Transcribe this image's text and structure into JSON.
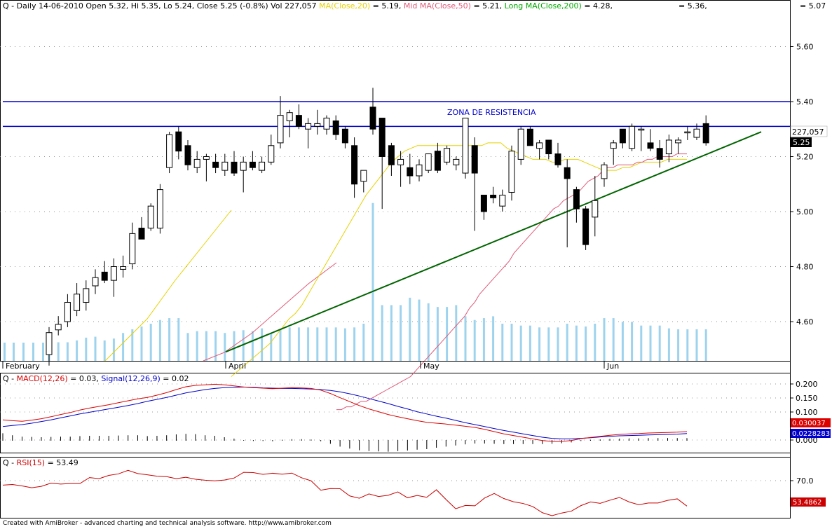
{
  "header": {
    "symbol": "Q",
    "title_main": "Q - Daily 14-06-2010 Open 5.32, Hi 5.35, Lo 5.24, Close 5.25 (-0.8%) Vol 227,057",
    "ma20_label": "MA(Close,20)",
    "ma20_value": "= 5.19,",
    "ma50_label": "Mid MA(Close,50)",
    "ma50_value": "= 5.21,",
    "ma200_label": "Long MA(Close,200)",
    "ma200_value": "= 4.28,",
    "extra_value_1": "= 5.36,",
    "extra_value_2": "= 5.07"
  },
  "price_panel": {
    "annotation": "ZONA DE RESISTENCIA",
    "volume_badge": "227,057",
    "close_badge": "5.25",
    "resistance_levels": [
      5.4,
      5.31
    ],
    "y_ticks": [
      "5.60",
      "5.40",
      "5.20",
      "5.00",
      "4.80",
      "4.60"
    ],
    "x_month_labels": [
      "February",
      "April",
      "May",
      "Jun"
    ]
  },
  "macd_panel": {
    "label_prefix": "Q - ",
    "macd_label": "MACD(12,26)",
    "macd_value": "= 0.03,",
    "signal_label": "Signal(12,26,9)",
    "signal_value": "= 0.02",
    "y_ticks": [
      "0.200",
      "0.150",
      "0.100",
      "0.000"
    ],
    "badge_macd": "0.030037",
    "badge_signal": "0.0228283"
  },
  "rsi_panel": {
    "label_prefix": "Q - ",
    "rsi_label": "RSI(15)",
    "rsi_value": "= 53.49",
    "y_ticks": [
      "70.0"
    ],
    "badge_rsi": "53.4862"
  },
  "footer": {
    "text": "Created with AmiBroker - advanced charting and technical analysis software. http://www.amibroker.com"
  },
  "colors": {
    "up_candle": "#ffffff",
    "down_candle": "#000000",
    "ma20": "#e6d200",
    "ma50": "#e05a78",
    "ma200": "#00aa00",
    "resistance": "#0000cc",
    "trendline": "#006400",
    "volume": "#9ed3ee",
    "macd": "#dd0000",
    "signal": "#0000cc",
    "rsi": "#cc0000"
  },
  "chart_data": {
    "type": "candlestick",
    "period": "Daily",
    "last_date": "14-06-2010",
    "candles": [
      {
        "o": 4.48,
        "h": 4.58,
        "l": 4.44,
        "c": 4.56
      },
      {
        "o": 4.57,
        "h": 4.62,
        "l": 4.55,
        "c": 4.59
      },
      {
        "o": 4.6,
        "h": 4.7,
        "l": 4.58,
        "c": 4.67
      },
      {
        "o": 4.64,
        "h": 4.74,
        "l": 4.62,
        "c": 4.7
      },
      {
        "o": 4.67,
        "h": 4.75,
        "l": 4.64,
        "c": 4.72
      },
      {
        "o": 4.73,
        "h": 4.79,
        "l": 4.7,
        "c": 4.76
      },
      {
        "o": 4.78,
        "h": 4.82,
        "l": 4.74,
        "c": 4.75
      },
      {
        "o": 4.75,
        "h": 4.83,
        "l": 4.69,
        "c": 4.8
      },
      {
        "o": 4.79,
        "h": 4.84,
        "l": 4.76,
        "c": 4.8
      },
      {
        "o": 4.81,
        "h": 4.96,
        "l": 4.79,
        "c": 4.92
      },
      {
        "o": 4.94,
        "h": 4.98,
        "l": 4.91,
        "c": 4.9
      },
      {
        "o": 4.94,
        "h": 5.03,
        "l": 4.93,
        "c": 5.02
      },
      {
        "o": 4.94,
        "h": 5.1,
        "l": 4.92,
        "c": 5.08
      },
      {
        "o": 5.16,
        "h": 5.29,
        "l": 5.14,
        "c": 5.28
      },
      {
        "o": 5.29,
        "h": 5.31,
        "l": 5.19,
        "c": 5.22
      },
      {
        "o": 5.24,
        "h": 5.26,
        "l": 5.15,
        "c": 5.17
      },
      {
        "o": 5.16,
        "h": 5.22,
        "l": 5.14,
        "c": 5.19
      },
      {
        "o": 5.19,
        "h": 5.21,
        "l": 5.11,
        "c": 5.2
      },
      {
        "o": 5.18,
        "h": 5.21,
        "l": 5.14,
        "c": 5.16
      },
      {
        "o": 5.15,
        "h": 5.21,
        "l": 5.13,
        "c": 5.18
      },
      {
        "o": 5.18,
        "h": 5.22,
        "l": 5.13,
        "c": 5.14
      },
      {
        "o": 5.15,
        "h": 5.2,
        "l": 5.07,
        "c": 5.18
      },
      {
        "o": 5.18,
        "h": 5.22,
        "l": 5.15,
        "c": 5.16
      },
      {
        "o": 5.15,
        "h": 5.2,
        "l": 5.14,
        "c": 5.18
      },
      {
        "o": 5.18,
        "h": 5.28,
        "l": 5.17,
        "c": 5.24
      },
      {
        "o": 5.25,
        "h": 5.42,
        "l": 5.23,
        "c": 5.35
      },
      {
        "o": 5.33,
        "h": 5.37,
        "l": 5.27,
        "c": 5.36
      },
      {
        "o": 5.35,
        "h": 5.39,
        "l": 5.3,
        "c": 5.31
      },
      {
        "o": 5.3,
        "h": 5.34,
        "l": 5.23,
        "c": 5.32
      },
      {
        "o": 5.31,
        "h": 5.37,
        "l": 5.28,
        "c": 5.32
      },
      {
        "o": 5.3,
        "h": 5.35,
        "l": 5.28,
        "c": 5.34
      },
      {
        "o": 5.33,
        "h": 5.35,
        "l": 5.26,
        "c": 5.28
      },
      {
        "o": 5.3,
        "h": 5.31,
        "l": 5.23,
        "c": 5.25
      },
      {
        "o": 5.24,
        "h": 5.27,
        "l": 5.05,
        "c": 5.1
      },
      {
        "o": 5.11,
        "h": 5.15,
        "l": 5.07,
        "c": 5.15
      },
      {
        "o": 5.38,
        "h": 5.45,
        "l": 5.28,
        "c": 5.3
      },
      {
        "o": 5.34,
        "h": 5.34,
        "l": 5.01,
        "c": 5.2
      },
      {
        "o": 5.24,
        "h": 5.25,
        "l": 5.13,
        "c": 5.17
      },
      {
        "o": 5.17,
        "h": 5.22,
        "l": 5.09,
        "c": 5.19
      },
      {
        "o": 5.16,
        "h": 5.21,
        "l": 5.1,
        "c": 5.13
      },
      {
        "o": 5.13,
        "h": 5.19,
        "l": 5.11,
        "c": 5.17
      },
      {
        "o": 5.15,
        "h": 5.21,
        "l": 5.14,
        "c": 5.21
      },
      {
        "o": 5.22,
        "h": 5.25,
        "l": 5.14,
        "c": 5.15
      },
      {
        "o": 5.18,
        "h": 5.24,
        "l": 5.17,
        "c": 5.23
      },
      {
        "o": 5.17,
        "h": 5.2,
        "l": 5.15,
        "c": 5.19
      },
      {
        "o": 5.14,
        "h": 5.34,
        "l": 5.12,
        "c": 5.34
      },
      {
        "o": 5.24,
        "h": 5.27,
        "l": 4.93,
        "c": 5.14
      },
      {
        "o": 5.06,
        "h": 5.06,
        "l": 4.97,
        "c": 5.0
      },
      {
        "o": 5.06,
        "h": 5.09,
        "l": 5.03,
        "c": 5.05
      },
      {
        "o": 5.02,
        "h": 5.08,
        "l": 5.0,
        "c": 5.06
      },
      {
        "o": 5.07,
        "h": 5.24,
        "l": 5.04,
        "c": 5.22
      },
      {
        "o": 5.19,
        "h": 5.31,
        "l": 5.17,
        "c": 5.3
      },
      {
        "o": 5.3,
        "h": 5.31,
        "l": 5.24,
        "c": 5.24
      },
      {
        "o": 5.23,
        "h": 5.26,
        "l": 5.19,
        "c": 5.25
      },
      {
        "o": 5.26,
        "h": 5.26,
        "l": 5.19,
        "c": 5.21
      },
      {
        "o": 5.21,
        "h": 5.25,
        "l": 5.16,
        "c": 5.17
      },
      {
        "o": 5.16,
        "h": 5.19,
        "l": 4.87,
        "c": 5.12
      },
      {
        "o": 5.08,
        "h": 5.09,
        "l": 4.96,
        "c": 5.01
      },
      {
        "o": 5.01,
        "h": 5.02,
        "l": 4.86,
        "c": 4.88
      },
      {
        "o": 4.98,
        "h": 5.13,
        "l": 4.91,
        "c": 5.04
      },
      {
        "o": 5.12,
        "h": 5.18,
        "l": 5.09,
        "c": 5.17
      },
      {
        "o": 5.23,
        "h": 5.26,
        "l": 5.17,
        "c": 5.25
      },
      {
        "o": 5.3,
        "h": 5.3,
        "l": 5.23,
        "c": 5.25
      },
      {
        "o": 5.23,
        "h": 5.32,
        "l": 5.22,
        "c": 5.31
      },
      {
        "o": 5.3,
        "h": 5.31,
        "l": 5.22,
        "c": 5.3
      },
      {
        "o": 5.25,
        "h": 5.3,
        "l": 5.22,
        "c": 5.23
      },
      {
        "o": 5.23,
        "h": 5.26,
        "l": 5.16,
        "c": 5.19
      },
      {
        "o": 5.21,
        "h": 5.28,
        "l": 5.18,
        "c": 5.26
      },
      {
        "o": 5.25,
        "h": 5.27,
        "l": 5.21,
        "c": 5.26
      },
      {
        "o": 5.29,
        "h": 5.31,
        "l": 5.26,
        "c": 5.29
      },
      {
        "o": 5.27,
        "h": 5.32,
        "l": 5.26,
        "c": 5.3
      },
      {
        "o": 5.32,
        "h": 5.35,
        "l": 5.24,
        "c": 5.25
      }
    ],
    "ma20": [
      4.4,
      4.42,
      4.44,
      4.46,
      4.48,
      4.5,
      4.52,
      4.55,
      4.58,
      4.61,
      4.63,
      4.66,
      4.7,
      4.74,
      4.78,
      4.82,
      4.86,
      4.9,
      4.94,
      4.98,
      5.02,
      5.06,
      5.09,
      5.12,
      5.15,
      5.18,
      5.2,
      5.22,
      5.23,
      5.24,
      5.24,
      5.24,
      5.24,
      5.24,
      5.24,
      5.24,
      5.24,
      5.24,
      5.24,
      5.24,
      5.25,
      5.25,
      5.25,
      5.23,
      5.22,
      5.21,
      5.2,
      5.19,
      5.19,
      5.19,
      5.18,
      5.18,
      5.19,
      5.19,
      5.19,
      5.18,
      5.17,
      5.16,
      5.15,
      5.15,
      5.15,
      5.16,
      5.16,
      5.17,
      5.18,
      5.18,
      5.18,
      5.18,
      5.19,
      5.19,
      5.19,
      5.19
    ],
    "ma50": [
      4.28,
      4.28,
      4.29,
      4.29,
      4.3,
      4.31,
      4.31,
      4.32,
      4.33,
      4.34,
      4.35,
      4.36,
      4.37,
      4.38,
      4.39,
      4.4,
      4.42,
      4.44,
      4.46,
      4.48,
      4.5,
      4.52,
      4.54,
      4.56,
      4.58,
      4.6,
      4.62,
      4.65,
      4.67,
      4.7,
      4.72,
      4.74,
      4.76,
      4.78,
      4.8,
      4.82,
      4.85,
      4.87,
      4.89,
      4.91,
      4.93,
      4.95,
      4.97,
      4.99,
      5.01,
      5.02,
      5.04,
      5.05,
      5.06,
      5.07,
      5.09,
      5.11,
      5.12,
      5.13,
      5.15,
      5.16,
      5.16,
      5.17,
      5.17,
      5.17,
      5.17,
      5.18,
      5.18,
      5.19,
      5.19,
      5.2,
      5.2,
      5.2,
      5.2,
      5.21,
      5.21,
      5.21
    ],
    "volume": [
      100,
      100,
      100,
      110,
      125,
      130,
      110,
      120,
      150,
      170,
      185,
      200,
      220,
      230,
      230,
      150,
      160,
      160,
      160,
      150,
      160,
      165,
      160,
      175,
      150,
      170,
      180,
      180,
      180,
      180,
      180,
      180,
      175,
      180,
      200,
      850,
      300,
      300,
      300,
      340,
      330,
      310,
      290,
      290,
      300,
      240,
      220,
      230,
      240,
      200,
      200,
      190,
      190,
      180,
      180,
      180,
      200,
      190,
      185,
      200,
      230,
      230,
      210,
      210,
      190,
      190,
      190,
      175,
      170,
      170,
      170,
      170
    ],
    "resistance_lines": [
      5.4,
      5.31
    ],
    "trendline": {
      "from_index": 26,
      "from_price": 4.49,
      "to_index": 87,
      "to_price": 5.29
    },
    "macd": [
      0.072,
      0.069,
      0.067,
      0.071,
      0.076,
      0.083,
      0.091,
      0.098,
      0.107,
      0.114,
      0.12,
      0.126,
      0.133,
      0.14,
      0.147,
      0.152,
      0.16,
      0.169,
      0.18,
      0.19,
      0.195,
      0.197,
      0.199,
      0.197,
      0.193,
      0.189,
      0.187,
      0.185,
      0.183,
      0.185,
      0.187,
      0.186,
      0.184,
      0.178,
      0.166,
      0.151,
      0.137,
      0.123,
      0.111,
      0.101,
      0.091,
      0.083,
      0.076,
      0.069,
      0.063,
      0.06,
      0.057,
      0.053,
      0.049,
      0.045,
      0.038,
      0.03,
      0.022,
      0.016,
      0.01,
      0.004,
      -0.002,
      -0.005,
      -0.005,
      -0.002,
      0.005,
      0.009,
      0.013,
      0.017,
      0.02,
      0.022,
      0.023,
      0.025,
      0.026,
      0.027,
      0.028,
      0.03
    ],
    "signal": [
      0.048,
      0.052,
      0.055,
      0.06,
      0.066,
      0.072,
      0.079,
      0.086,
      0.093,
      0.099,
      0.105,
      0.111,
      0.117,
      0.123,
      0.13,
      0.138,
      0.145,
      0.152,
      0.16,
      0.168,
      0.174,
      0.18,
      0.184,
      0.187,
      0.188,
      0.189,
      0.188,
      0.186,
      0.185,
      0.184,
      0.184,
      0.183,
      0.182,
      0.18,
      0.177,
      0.172,
      0.165,
      0.157,
      0.148,
      0.139,
      0.13,
      0.12,
      0.111,
      0.101,
      0.093,
      0.085,
      0.078,
      0.07,
      0.062,
      0.055,
      0.048,
      0.041,
      0.034,
      0.028,
      0.022,
      0.016,
      0.01,
      0.006,
      0.004,
      0.004,
      0.006,
      0.008,
      0.011,
      0.013,
      0.015,
      0.016,
      0.017,
      0.018,
      0.019,
      0.02,
      0.021,
      0.023
    ],
    "rsi": [
      67.1,
      67.5,
      66.6,
      65.4,
      66.3,
      68.4,
      67.8,
      68.1,
      68.1,
      72.0,
      71.3,
      73.4,
      74.4,
      76.7,
      74.6,
      73.8,
      72.9,
      72.6,
      71.3,
      72.2,
      70.9,
      70.3,
      69.9,
      70.4,
      71.7,
      75.4,
      75.2,
      74.1,
      74.8,
      74.2,
      74.9,
      71.9,
      69.9,
      63.8,
      64.9,
      64.8,
      60.1,
      58.6,
      61.4,
      59.7,
      60.5,
      62.7,
      58.9,
      60.4,
      59.2,
      64.1,
      57.8,
      51.8,
      53.9,
      53.7,
      58.7,
      61.7,
      58.4,
      56.3,
      55.2,
      53.2,
      49.2,
      47.3,
      49.0,
      50.2,
      53.8,
      56.2,
      55.3,
      57.3,
      59.1,
      56.2,
      54.4,
      55.5,
      55.5,
      57.2,
      58.2,
      53.5
    ]
  }
}
